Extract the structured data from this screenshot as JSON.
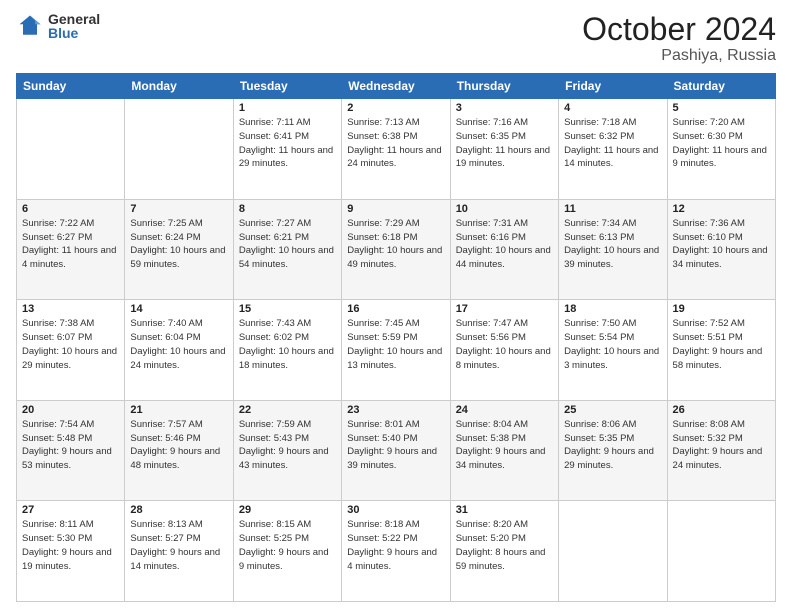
{
  "logo": {
    "general": "General",
    "blue": "Blue"
  },
  "header": {
    "month": "October 2024",
    "location": "Pashiya, Russia"
  },
  "days_of_week": [
    "Sunday",
    "Monday",
    "Tuesday",
    "Wednesday",
    "Thursday",
    "Friday",
    "Saturday"
  ],
  "weeks": [
    [
      {
        "day": "",
        "info": ""
      },
      {
        "day": "",
        "info": ""
      },
      {
        "day": "1",
        "info": "Sunrise: 7:11 AM\nSunset: 6:41 PM\nDaylight: 11 hours\nand 29 minutes."
      },
      {
        "day": "2",
        "info": "Sunrise: 7:13 AM\nSunset: 6:38 PM\nDaylight: 11 hours\nand 24 minutes."
      },
      {
        "day": "3",
        "info": "Sunrise: 7:16 AM\nSunset: 6:35 PM\nDaylight: 11 hours\nand 19 minutes."
      },
      {
        "day": "4",
        "info": "Sunrise: 7:18 AM\nSunset: 6:32 PM\nDaylight: 11 hours\nand 14 minutes."
      },
      {
        "day": "5",
        "info": "Sunrise: 7:20 AM\nSunset: 6:30 PM\nDaylight: 11 hours\nand 9 minutes."
      }
    ],
    [
      {
        "day": "6",
        "info": "Sunrise: 7:22 AM\nSunset: 6:27 PM\nDaylight: 11 hours\nand 4 minutes."
      },
      {
        "day": "7",
        "info": "Sunrise: 7:25 AM\nSunset: 6:24 PM\nDaylight: 10 hours\nand 59 minutes."
      },
      {
        "day": "8",
        "info": "Sunrise: 7:27 AM\nSunset: 6:21 PM\nDaylight: 10 hours\nand 54 minutes."
      },
      {
        "day": "9",
        "info": "Sunrise: 7:29 AM\nSunset: 6:18 PM\nDaylight: 10 hours\nand 49 minutes."
      },
      {
        "day": "10",
        "info": "Sunrise: 7:31 AM\nSunset: 6:16 PM\nDaylight: 10 hours\nand 44 minutes."
      },
      {
        "day": "11",
        "info": "Sunrise: 7:34 AM\nSunset: 6:13 PM\nDaylight: 10 hours\nand 39 minutes."
      },
      {
        "day": "12",
        "info": "Sunrise: 7:36 AM\nSunset: 6:10 PM\nDaylight: 10 hours\nand 34 minutes."
      }
    ],
    [
      {
        "day": "13",
        "info": "Sunrise: 7:38 AM\nSunset: 6:07 PM\nDaylight: 10 hours\nand 29 minutes."
      },
      {
        "day": "14",
        "info": "Sunrise: 7:40 AM\nSunset: 6:04 PM\nDaylight: 10 hours\nand 24 minutes."
      },
      {
        "day": "15",
        "info": "Sunrise: 7:43 AM\nSunset: 6:02 PM\nDaylight: 10 hours\nand 18 minutes."
      },
      {
        "day": "16",
        "info": "Sunrise: 7:45 AM\nSunset: 5:59 PM\nDaylight: 10 hours\nand 13 minutes."
      },
      {
        "day": "17",
        "info": "Sunrise: 7:47 AM\nSunset: 5:56 PM\nDaylight: 10 hours\nand 8 minutes."
      },
      {
        "day": "18",
        "info": "Sunrise: 7:50 AM\nSunset: 5:54 PM\nDaylight: 10 hours\nand 3 minutes."
      },
      {
        "day": "19",
        "info": "Sunrise: 7:52 AM\nSunset: 5:51 PM\nDaylight: 9 hours\nand 58 minutes."
      }
    ],
    [
      {
        "day": "20",
        "info": "Sunrise: 7:54 AM\nSunset: 5:48 PM\nDaylight: 9 hours\nand 53 minutes."
      },
      {
        "day": "21",
        "info": "Sunrise: 7:57 AM\nSunset: 5:46 PM\nDaylight: 9 hours\nand 48 minutes."
      },
      {
        "day": "22",
        "info": "Sunrise: 7:59 AM\nSunset: 5:43 PM\nDaylight: 9 hours\nand 43 minutes."
      },
      {
        "day": "23",
        "info": "Sunrise: 8:01 AM\nSunset: 5:40 PM\nDaylight: 9 hours\nand 39 minutes."
      },
      {
        "day": "24",
        "info": "Sunrise: 8:04 AM\nSunset: 5:38 PM\nDaylight: 9 hours\nand 34 minutes."
      },
      {
        "day": "25",
        "info": "Sunrise: 8:06 AM\nSunset: 5:35 PM\nDaylight: 9 hours\nand 29 minutes."
      },
      {
        "day": "26",
        "info": "Sunrise: 8:08 AM\nSunset: 5:32 PM\nDaylight: 9 hours\nand 24 minutes."
      }
    ],
    [
      {
        "day": "27",
        "info": "Sunrise: 8:11 AM\nSunset: 5:30 PM\nDaylight: 9 hours\nand 19 minutes."
      },
      {
        "day": "28",
        "info": "Sunrise: 8:13 AM\nSunset: 5:27 PM\nDaylight: 9 hours\nand 14 minutes."
      },
      {
        "day": "29",
        "info": "Sunrise: 8:15 AM\nSunset: 5:25 PM\nDaylight: 9 hours\nand 9 minutes."
      },
      {
        "day": "30",
        "info": "Sunrise: 8:18 AM\nSunset: 5:22 PM\nDaylight: 9 hours\nand 4 minutes."
      },
      {
        "day": "31",
        "info": "Sunrise: 8:20 AM\nSunset: 5:20 PM\nDaylight: 8 hours\nand 59 minutes."
      },
      {
        "day": "",
        "info": ""
      },
      {
        "day": "",
        "info": ""
      }
    ]
  ]
}
